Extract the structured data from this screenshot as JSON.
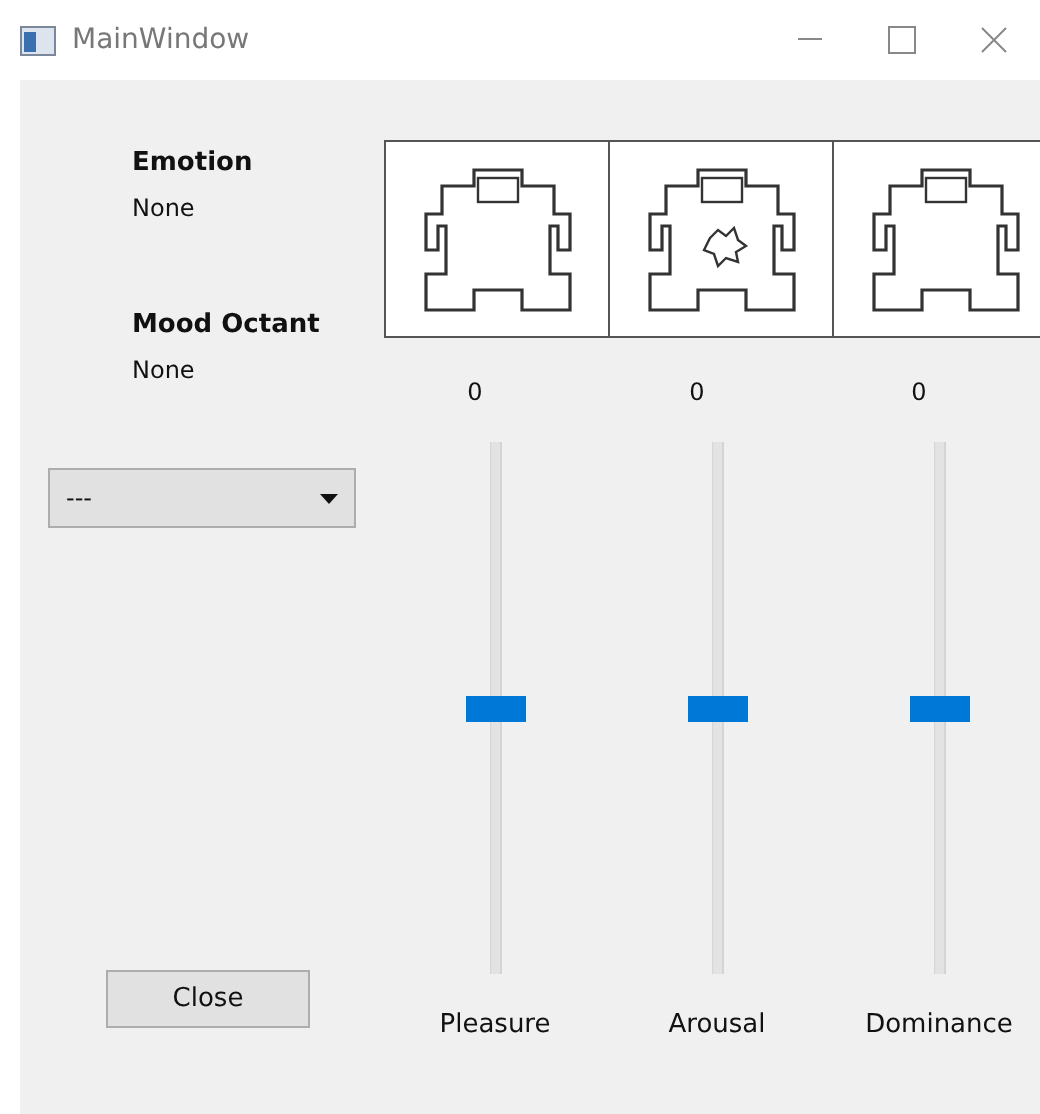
{
  "window": {
    "title": "MainWindow"
  },
  "emotion": {
    "label": "Emotion",
    "value": "None"
  },
  "mood_octant": {
    "label": "Mood Octant",
    "value": "None"
  },
  "dropdown": {
    "value": "---"
  },
  "figures": [
    {
      "kind": "plain"
    },
    {
      "kind": "burst"
    },
    {
      "kind": "plain"
    }
  ],
  "sliders": [
    {
      "reading": "0",
      "level": 0.5,
      "label": "Pleasure"
    },
    {
      "reading": "0",
      "level": 0.5,
      "label": "Arousal"
    },
    {
      "reading": "0",
      "level": 0.5,
      "label": "Dominance"
    }
  ],
  "close_button": "Close"
}
